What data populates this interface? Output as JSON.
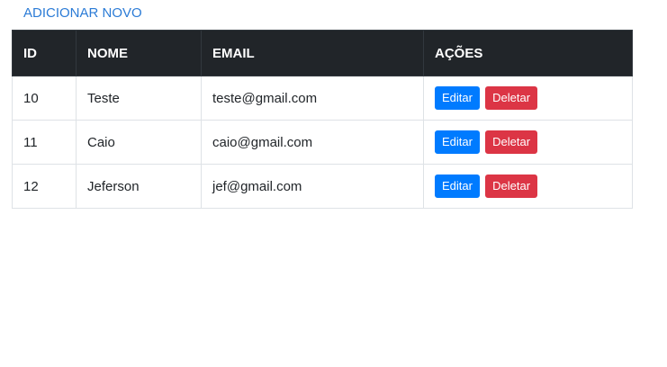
{
  "add_link": "ADICIONAR NOVO",
  "table": {
    "headers": [
      "ID",
      "NOME",
      "EMAIL",
      "AÇÕES"
    ],
    "rows": [
      {
        "id": "10",
        "nome": "Teste",
        "email": "teste@gmail.com"
      },
      {
        "id": "11",
        "nome": "Caio",
        "email": "caio@gmail.com"
      },
      {
        "id": "12",
        "nome": "Jeferson",
        "email": "jef@gmail.com"
      }
    ],
    "edit_label": "Editar",
    "delete_label": "Deletar"
  },
  "colors": {
    "link": "#2b7bd6",
    "header_bg": "#212529",
    "edit": "#007bff",
    "delete": "#dc3545"
  }
}
